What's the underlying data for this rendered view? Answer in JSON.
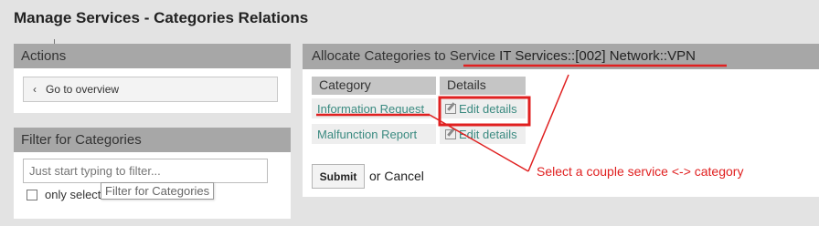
{
  "page_title": "Manage Services - Categories Relations",
  "actions": {
    "title": "Actions",
    "overview_label": "Go to overview"
  },
  "filter": {
    "title": "Filter for Categories",
    "placeholder": "Just start typing to filter...",
    "only_selected_label": "only selected",
    "tooltip": "Filter for Categories"
  },
  "allocate": {
    "title_prefix": "Allocate Categories to Service",
    "service_name": "IT Services::[002] Network::VPN",
    "col_category": "Category",
    "col_details": "Details",
    "rows": [
      {
        "category": "Information Request",
        "details": "Edit details"
      },
      {
        "category": "Malfunction Report",
        "details": "Edit details"
      }
    ],
    "submit_label": "Submit",
    "cancel_text": "or Cancel"
  },
  "annotation": {
    "text": "Select a couple service <-> category",
    "color": "#e02020"
  },
  "icons": [
    "chevron-left-icon",
    "edit-icon"
  ],
  "colors": {
    "page_bg": "#e3e3e3",
    "panel_header_bg": "#a7a7a7",
    "link_teal": "#3a8a80"
  }
}
